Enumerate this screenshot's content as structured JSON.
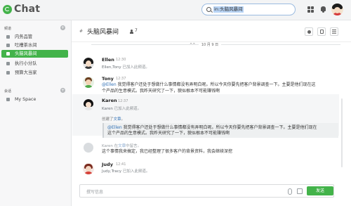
{
  "app": {
    "title": "Chat"
  },
  "search": {
    "value": "in:头脑风暴间"
  },
  "sidebar": {
    "channels_header": "频道",
    "add_symbol": "+",
    "items": [
      {
        "label": "内务品管",
        "active": false
      },
      {
        "label": "吐槽茶水间",
        "active": false
      },
      {
        "label": "头脑风暴间",
        "active": true
      },
      {
        "label": "执行小分队",
        "active": false
      },
      {
        "label": "预算大当家",
        "active": false
      }
    ],
    "private_header": "会话",
    "private_items": [
      {
        "label": "My Space"
      }
    ]
  },
  "channel": {
    "hash": "#",
    "title": "头脑风暴间",
    "member_count": "7"
  },
  "collapse_mark": "^^",
  "date_divider": "10 月 9 日",
  "messages": [
    {
      "name": "Ellen",
      "time": "12:30",
      "system_who": "Ellen,Tony",
      "system_text": " 已加入此频道。"
    },
    {
      "name": "Tony",
      "time": "12:37",
      "mention": "@Ellen",
      "line1": " 我觉得客户还处于想做什么事情都没有弄明白呢。所以今天你要先把客户背景调查一下。主要是他们现在这",
      "line2": "个产品的生意模式。我昨天研究了一下，貌似根本不可能赚钱啊"
    },
    {
      "name": "Karen",
      "time": "12:37",
      "system_who": "Karen",
      "system_text": " 已加入此频道。",
      "quote_prefix": "创建了",
      "quote_link": "文章",
      "quote_suffix": "。",
      "quote_mention": "@Ellen",
      "quote_line1": " 我觉得客户还处于想做什么事情都没有弄明白呢。所以今天你要先把客户背景调查一下。主要是他们现在",
      "quote_line2": "这个产品的生意模式。我昨天研究了一下，貌似根本不可能赚钱啊"
    },
    {
      "ghost_prefix": "Karen 在",
      "ghost_link": "文章",
      "ghost_suffix": "中留言。",
      "text": "这个事情我来搞定，我已经整理了很多客户的背景资料，我会继续深挖"
    },
    {
      "name": "Judy",
      "time": "12:41",
      "system_who": "Judy,Tracy",
      "system_text": " 已加入此频道。"
    }
  ],
  "composer": {
    "placeholder": "撰写信息",
    "send_label": "发送"
  },
  "colors": {
    "accent": "#43b34a",
    "link": "#2f6fb5"
  }
}
